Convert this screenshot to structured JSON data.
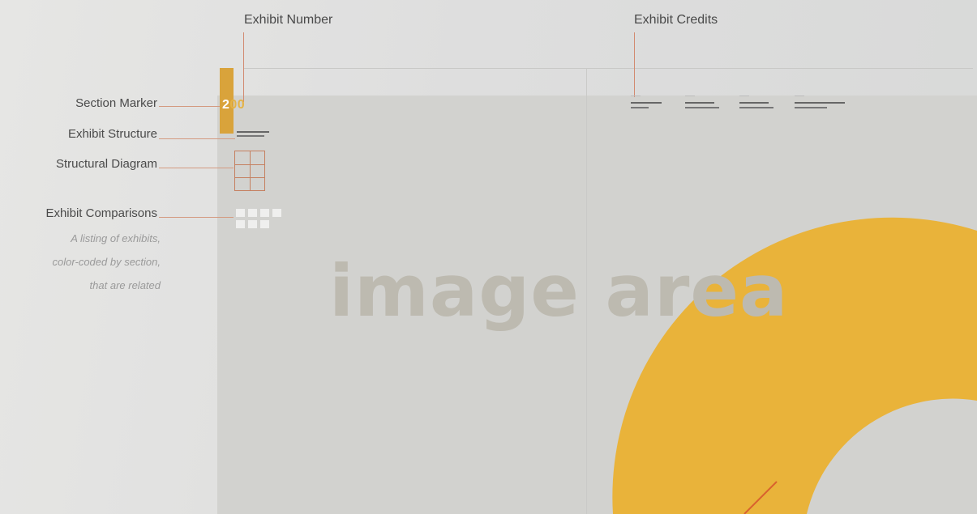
{
  "colors": {
    "section_accent": "#d9a33b",
    "callout_line": "#d28a70",
    "panel_background": "#d2d2cf"
  },
  "callouts": {
    "exhibit_number": "Exhibit Number",
    "exhibit_credits": "Exhibit Credits",
    "section_marker": "Section Marker",
    "exhibit_structure": "Exhibit Structure",
    "structural_diagram": "Structural Diagram",
    "exhibit_comparisons": "Exhibit Comparisons",
    "comparisons_description": [
      "A listing of exhibits,",
      "color-coded by section,",
      "that are related"
    ]
  },
  "panel": {
    "exhibit_number_first_digit": "2",
    "exhibit_number_rest": "00",
    "image_placeholder": "image area"
  }
}
